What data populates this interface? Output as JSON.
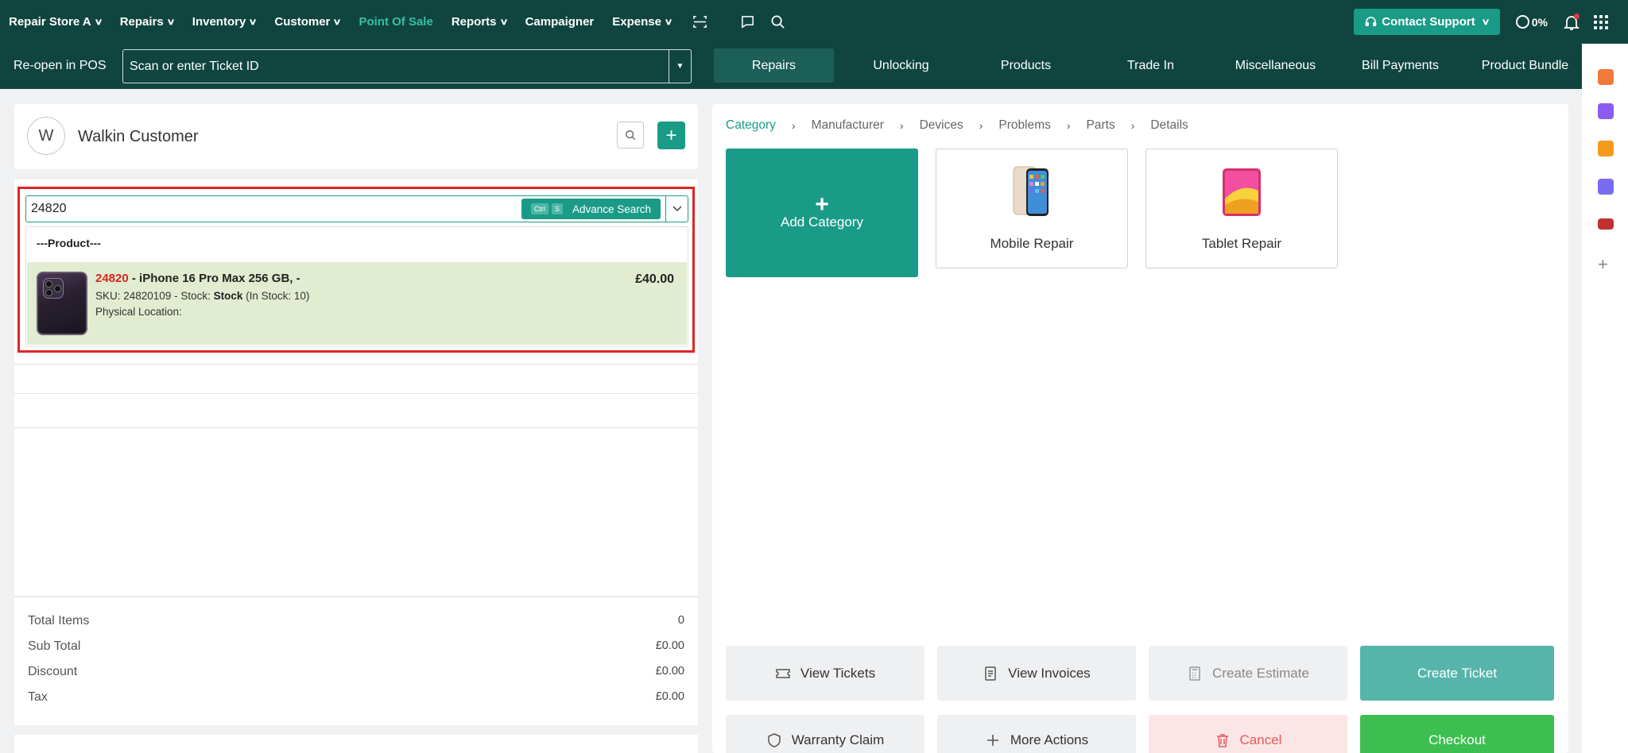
{
  "topnav": {
    "items": [
      {
        "label": "Repair Store A",
        "has_dropdown": true
      },
      {
        "label": "Repairs",
        "has_dropdown": true
      },
      {
        "label": "Inventory",
        "has_dropdown": true
      },
      {
        "label": "Customer",
        "has_dropdown": true
      },
      {
        "label": "Point Of Sale",
        "has_dropdown": false,
        "active": true
      },
      {
        "label": "Reports",
        "has_dropdown": true
      },
      {
        "label": "Campaigner",
        "has_dropdown": false
      },
      {
        "label": "Expense",
        "has_dropdown": true
      }
    ],
    "icons": [
      "scan-icon",
      "chat-icon",
      "search-icon"
    ],
    "contact_support": "Contact Support",
    "progress": "0%",
    "colors": {
      "bar": "#10453f",
      "accent": "#1a9b87",
      "active_nav": "#37c0a2"
    }
  },
  "subbar": {
    "reopen_label": "Re-open in POS",
    "ticket_placeholder": "Scan or enter Ticket ID",
    "tabs": [
      "Repairs",
      "Unlocking",
      "Products",
      "Trade In",
      "Miscellaneous",
      "Bill Payments",
      "Product Bundle"
    ],
    "active_tab": "Repairs"
  },
  "customer": {
    "avatar_letter": "W",
    "name": "Walkin Customer"
  },
  "product_search": {
    "value": "24820",
    "shortcut_keys": [
      "Ctrl",
      "S"
    ],
    "advance_label": "Advance Search",
    "group_label": "---Product---",
    "result": {
      "code": "24820",
      "title_rest": " - iPhone 16 Pro Max 256 GB, -",
      "sku_prefix": "SKU: 24820109 - Stock: ",
      "stock_label": "Stock",
      "stock_suffix": " (In Stock: 10)",
      "location": "Physical Location:",
      "price": "£40.00"
    }
  },
  "totals": [
    {
      "label": "Total Items",
      "value": "0"
    },
    {
      "label": "Sub Total",
      "value": "£0.00"
    },
    {
      "label": "Discount",
      "value": "£0.00"
    },
    {
      "label": "Tax",
      "value": "£0.00"
    }
  ],
  "breadcrumb": [
    "Category",
    "Manufacturer",
    "Devices",
    "Problems",
    "Parts",
    "Details"
  ],
  "tiles": {
    "add_category": "Add Category",
    "mobile_repair": "Mobile Repair",
    "tablet_repair": "Tablet Repair"
  },
  "actions": {
    "view_tickets": "View Tickets",
    "view_invoices": "View Invoices",
    "create_estimate": "Create Estimate",
    "create_ticket": "Create Ticket",
    "warranty_claim": "Warranty Claim",
    "more_actions": "More Actions",
    "cancel": "Cancel",
    "checkout": "Checkout"
  }
}
